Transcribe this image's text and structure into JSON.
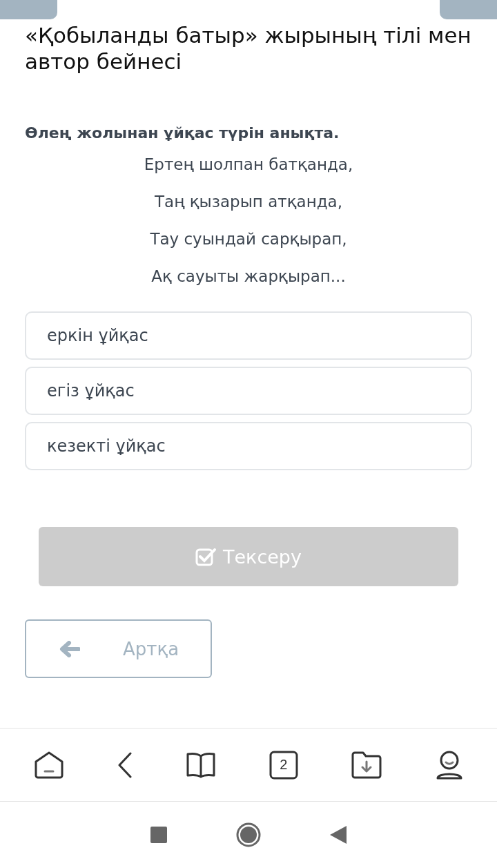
{
  "title": "«Қобыланды батыр» жырының тілі мен автор бейнесі",
  "question": "Өлең жолынан ұйқас түрін анықта.",
  "poem": [
    "Ертең шолпан батқанда,",
    "Таң қызарып атқанда,",
    "Тау суындай сарқырап,",
    "Ақ сауыты жарқырап..."
  ],
  "options": [
    {
      "label": "еркін ұйқас",
      "selected": false
    },
    {
      "label": "егіз ұйқас",
      "selected": false
    },
    {
      "label": "кезекті ұйқас",
      "selected": false
    }
  ],
  "check_button": {
    "label": "Тексеру",
    "disabled": true
  },
  "back_button": {
    "label": "Артқа"
  },
  "tabs_count": "2"
}
